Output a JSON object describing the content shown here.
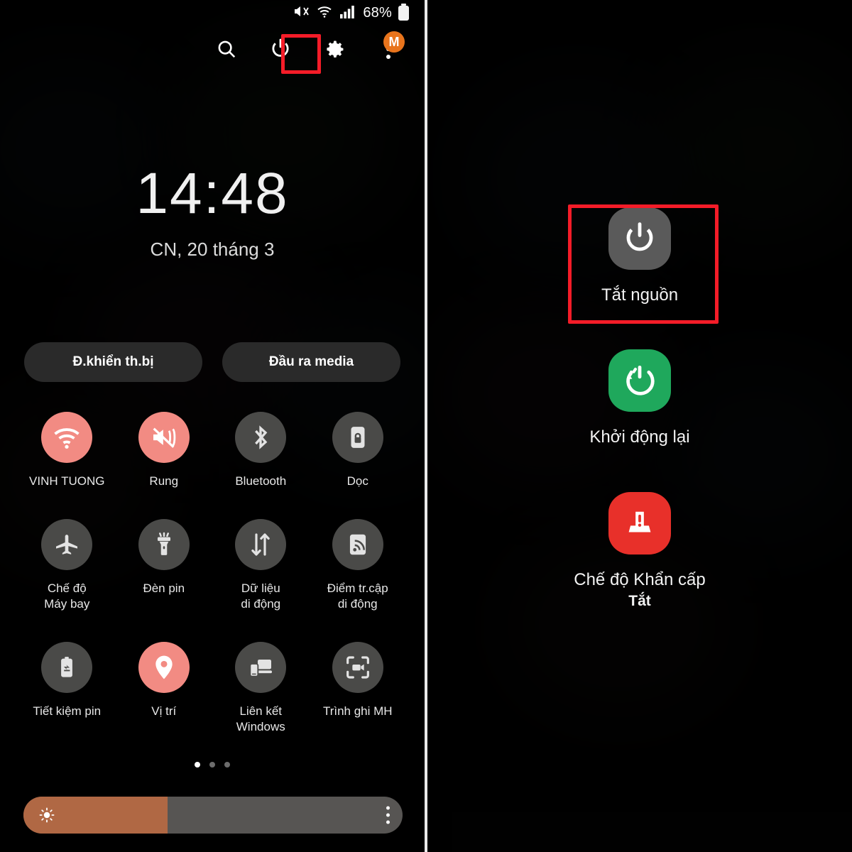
{
  "meta": {
    "colors": {
      "accent_on": "#F28B83",
      "toggle_off": "#4A4A48",
      "highlight_box": "#F41C28",
      "brightness_fill": "#B06844",
      "brightness_track": "#575553",
      "restart_green": "#1FA85C",
      "emergency_red": "#E8302A",
      "avatar_orange": "#E8741C",
      "background": "#050505"
    }
  },
  "left_panel": {
    "status_bar": {
      "icons": [
        "mute-icon",
        "wifi-icon",
        "signal-icon"
      ],
      "battery_percent": "68%"
    },
    "header_icons": [
      {
        "name": "search-icon",
        "label": "Tìm kiếm"
      },
      {
        "name": "power-icon",
        "label": "Nguồn",
        "highlighted": true
      },
      {
        "name": "gear-icon",
        "label": "Cài đặt"
      },
      {
        "name": "more-options-icon",
        "label": "Tùy chọn khác",
        "badge": "M"
      }
    ],
    "clock": {
      "time": "14:48",
      "date": "CN, 20 tháng 3"
    },
    "pills": [
      {
        "label": "Đ.khiển th.bị",
        "name": "device-control-button"
      },
      {
        "label": "Đầu ra media",
        "name": "media-output-button"
      }
    ],
    "toggles": [
      [
        {
          "label": "VINH TUONG",
          "icon": "wifi-icon",
          "active": true
        },
        {
          "label": "Rung",
          "icon": "vibrate-icon",
          "active": true
        },
        {
          "label": "Bluetooth",
          "icon": "bluetooth-icon",
          "active": false
        },
        {
          "label": "Dọc",
          "icon": "rotation-lock-icon",
          "active": false
        }
      ],
      [
        {
          "label": "Chế độ\nMáy bay",
          "icon": "airplane-icon",
          "active": false
        },
        {
          "label": "Đèn pin",
          "icon": "flashlight-icon",
          "active": false
        },
        {
          "label": "Dữ liệu\ndi động",
          "icon": "mobile-data-icon",
          "active": false
        },
        {
          "label": "Điểm tr.cập\ndi động",
          "icon": "hotspot-icon",
          "active": false
        }
      ],
      [
        {
          "label": "Tiết kiệm pin",
          "icon": "battery-saver-icon",
          "active": false
        },
        {
          "label": "Vị trí",
          "icon": "location-pin-icon",
          "active": true
        },
        {
          "label": "Liên kết\nWindows",
          "icon": "link-to-windows-icon",
          "active": false
        },
        {
          "label": "Trình ghi MH",
          "icon": "screen-recorder-icon",
          "active": false
        }
      ]
    ],
    "page_indicator": {
      "total": 3,
      "active": 1
    },
    "brightness": {
      "percent": 38,
      "icon": "brightness-sun-icon",
      "menu_icon": "more-options-icon"
    }
  },
  "right_panel": {
    "power_menu": [
      {
        "label": "Tắt nguồn",
        "sub": "",
        "icon": "power-icon",
        "color": "gray",
        "highlighted": true
      },
      {
        "label": "Khởi động lại",
        "sub": "",
        "icon": "restart-icon",
        "color": "green",
        "highlighted": false
      },
      {
        "label": "Chế độ Khẩn cấp",
        "sub": "Tắt",
        "icon": "emergency-icon",
        "color": "red",
        "highlighted": false
      }
    ]
  }
}
